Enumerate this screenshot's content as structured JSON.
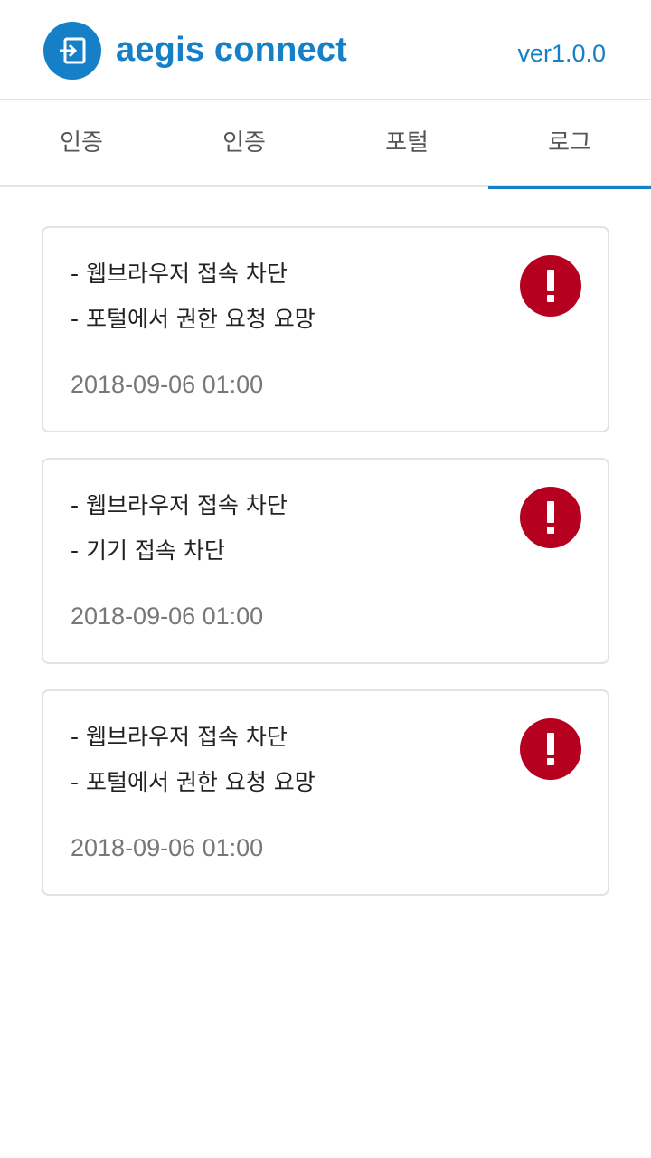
{
  "header": {
    "logo_icon": "sign-in-icon",
    "brand_color": "#1580c7",
    "title": "aegis connect",
    "version": "ver1.0.0"
  },
  "tabs": [
    {
      "label": "인증",
      "active": false
    },
    {
      "label": "인증",
      "active": false
    },
    {
      "label": "포털",
      "active": false
    },
    {
      "label": "로그",
      "active": true
    }
  ],
  "logs": [
    {
      "line1": "- 웹브라우저 접속 차단",
      "line2": "- 포털에서 권한 요청 요망",
      "date": "2018-09-06 01:00",
      "icon": "alert-icon",
      "icon_color": "#b5001f"
    },
    {
      "line1": "- 웹브라우저 접속 차단",
      "line2": "- 기기 접속 차단",
      "date": "2018-09-06 01:00",
      "icon": "alert-icon",
      "icon_color": "#b5001f"
    },
    {
      "line1": "- 웹브라우저 접속 차단",
      "line2": "- 포털에서 권한 요청 요망",
      "date": "2018-09-06 01:00",
      "icon": "alert-icon",
      "icon_color": "#b5001f"
    }
  ]
}
